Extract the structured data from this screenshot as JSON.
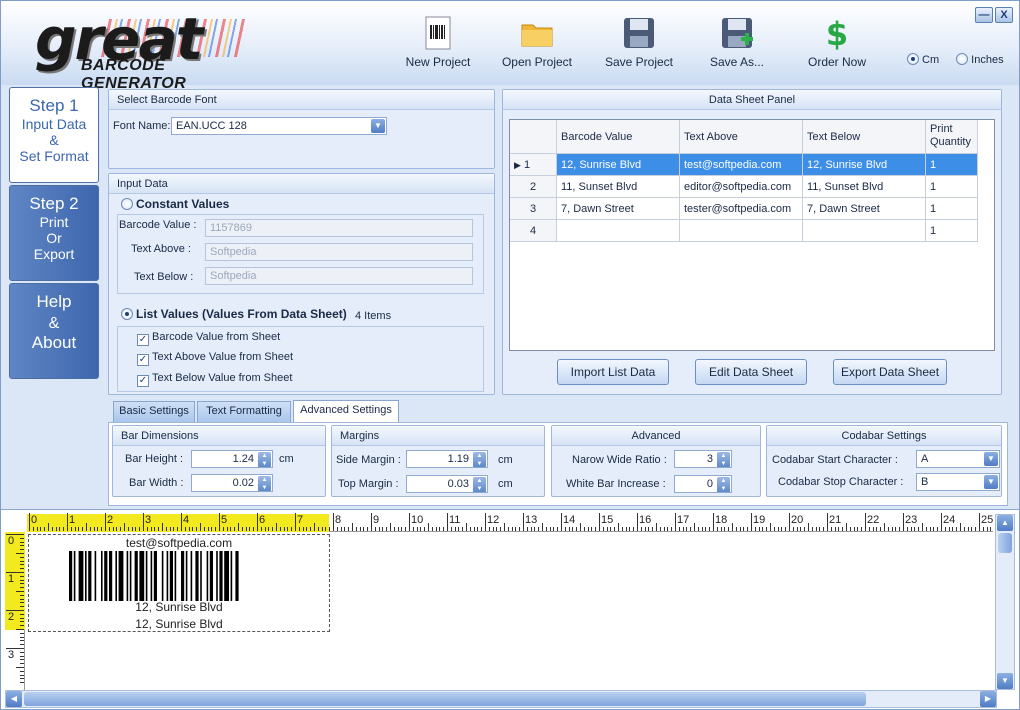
{
  "header": {
    "logo_main": "great",
    "logo_sub": "BARCODE GENERATOR",
    "toolbar": [
      {
        "name": "new-project-button",
        "icon": "barcode-document-icon",
        "label": "New  Project"
      },
      {
        "name": "open-project-button",
        "icon": "folder-icon",
        "label": "Open  Project"
      },
      {
        "name": "save-project-button",
        "icon": "floppy-disk-icon",
        "label": "Save Project"
      },
      {
        "name": "save-as-button",
        "icon": "floppy-disk-plus-icon",
        "label": "Save As..."
      },
      {
        "name": "order-now-button",
        "icon": "dollar-sign-icon",
        "label": "Order Now"
      }
    ],
    "units": {
      "cm": "Cm",
      "inches": "Inches",
      "selected": "Cm"
    },
    "window": {
      "minimize": "—",
      "close": "X"
    }
  },
  "steps": [
    {
      "title": "Step 1",
      "lines": [
        "Input Data",
        "&",
        "Set Format"
      ],
      "active": true
    },
    {
      "title": "Step 2",
      "lines": [
        "Print",
        "Or",
        "Export"
      ],
      "active": false
    },
    {
      "title": "Help",
      "lines": [
        "&",
        "About"
      ],
      "active": false
    }
  ],
  "font_panel": {
    "title": "Select Barcode Font",
    "font_label": "Font Name:",
    "font_value": "EAN.UCC 128"
  },
  "input_panel": {
    "title": "Input Data",
    "constant_label": "Constant Values",
    "barcode_value_label": "Barcode Value :",
    "barcode_value": "1157869",
    "text_above_label": "Text Above :",
    "text_above": "Softpedia",
    "text_below_label": "Text Below :",
    "text_below": "Softpedia",
    "list_label": "List Values (Values From Data Sheet)",
    "items_count": "4 Items",
    "checks": [
      "Barcode Value from Sheet",
      "Text Above Value from Sheet",
      "Text Below Value from Sheet"
    ]
  },
  "data_sheet": {
    "title": "Data Sheet Panel",
    "columns": [
      "Barcode Value",
      "Text Above",
      "Text Below",
      "Print Quantity"
    ],
    "rows": [
      {
        "num": "1",
        "barcode": "12, Sunrise Blvd",
        "above": "test@softpedia.com",
        "below": "12, Sunrise Blvd",
        "qty": "1"
      },
      {
        "num": "2",
        "barcode": "11, Sunset Blvd",
        "above": "editor@softpedia.com",
        "below": "11, Sunset Blvd",
        "qty": "1"
      },
      {
        "num": "3",
        "barcode": "7, Dawn Street",
        "above": "tester@softpedia.com",
        "below": "7, Dawn Street",
        "qty": "1"
      },
      {
        "num": "4",
        "barcode": "",
        "above": "",
        "below": "",
        "qty": "1"
      }
    ],
    "import_btn": "Import List Data",
    "edit_btn": "Edit Data Sheet",
    "export_btn": "Export Data Sheet"
  },
  "tabs": [
    "Basic Settings",
    "Text Formatting",
    "Advanced Settings"
  ],
  "bar_dimensions": {
    "title": "Bar Dimensions",
    "height_label": "Bar Height :",
    "height_value": "1.24",
    "width_label": "Bar Width :",
    "width_value": "0.02",
    "unit": "cm"
  },
  "margins": {
    "title": "Margins",
    "side_label": "Side Margin :",
    "side_value": "1.19",
    "top_label": "Top Margin :",
    "top_value": "0.03",
    "unit": "cm"
  },
  "advanced": {
    "title": "Advanced",
    "ratio_label": "Narow Wide Ratio :",
    "ratio_value": "3",
    "white_label": "White Bar Increase :",
    "white_value": "0"
  },
  "codabar": {
    "title": "Codabar Settings",
    "start_label": "Codabar Start Character :",
    "start_value": "A",
    "stop_label": "Codabar Stop Character :",
    "stop_value": "B"
  },
  "preview": {
    "text_above": "test@softpedia.com",
    "human_readable": "12, Sunrise Blvd",
    "text_below": "12, Sunrise Blvd",
    "ruler_h": [
      "0",
      "1",
      "2",
      "3",
      "4",
      "5",
      "6",
      "7",
      "8",
      "9",
      "10",
      "11",
      "12",
      "13",
      "14",
      "15",
      "16",
      "17",
      "18",
      "19",
      "20",
      "21",
      "22",
      "23",
      "24",
      "25"
    ],
    "ruler_v": [
      "0",
      "1",
      "2",
      "3"
    ]
  }
}
